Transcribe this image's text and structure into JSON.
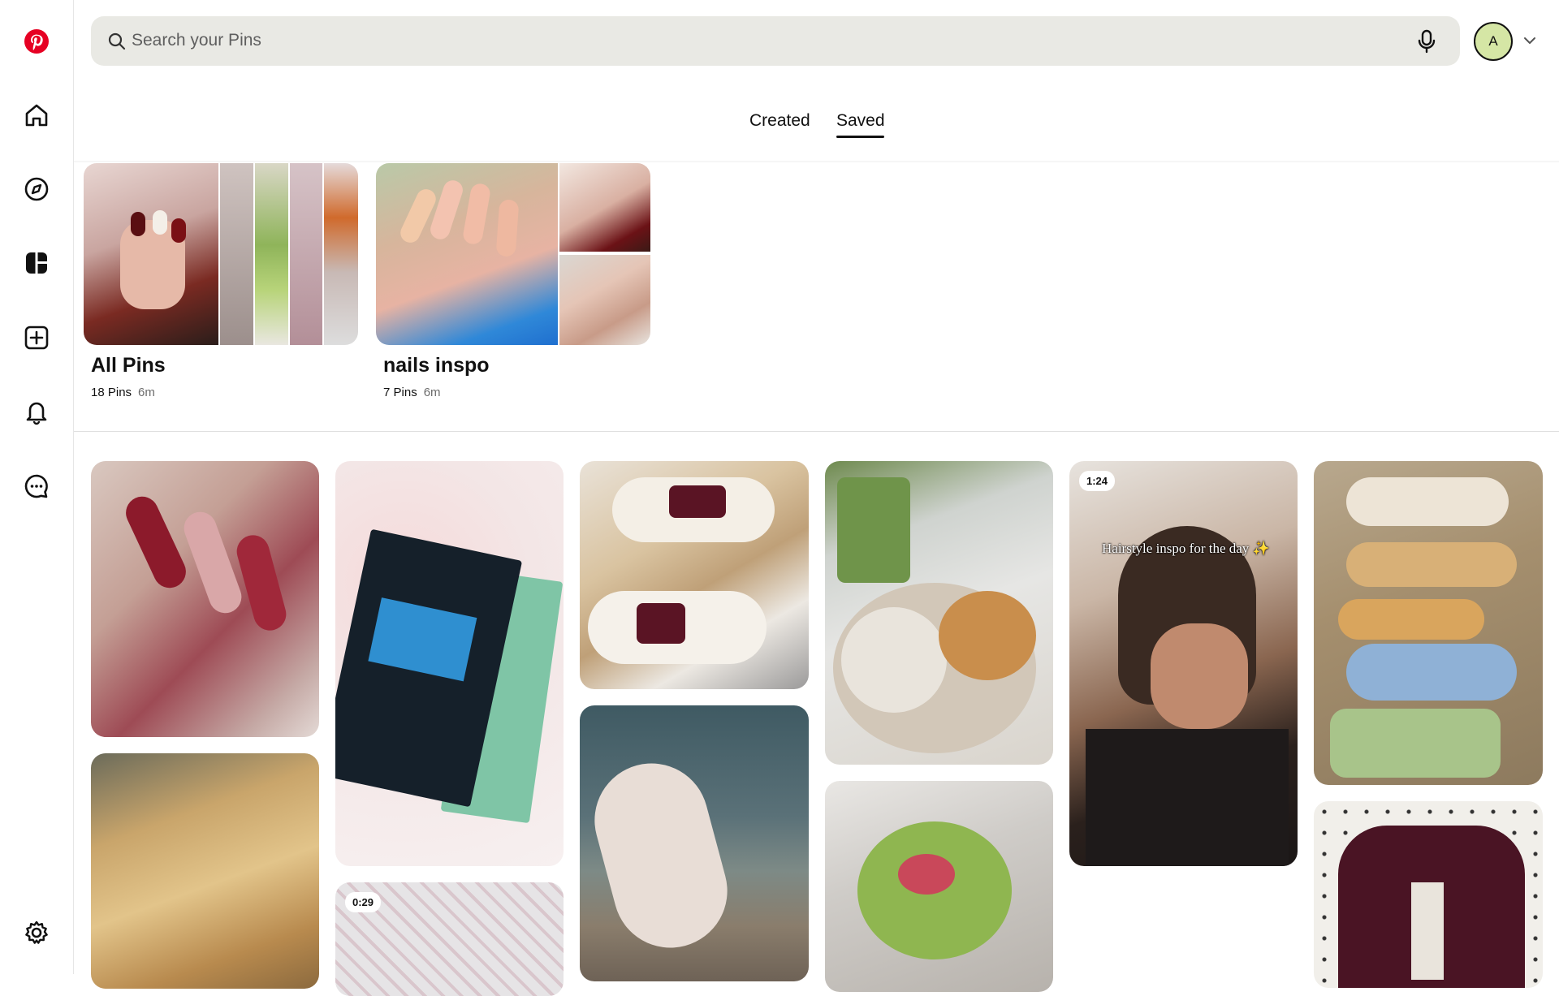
{
  "search": {
    "placeholder": "Search your Pins"
  },
  "user": {
    "avatar_letter": "A"
  },
  "tabs": [
    {
      "label": "Created"
    },
    {
      "label": "Saved"
    }
  ],
  "active_tab": "Saved",
  "boards": [
    {
      "title": "All Pins",
      "count": "18 Pins",
      "updated": "6m"
    },
    {
      "title": "nails inspo",
      "count": "7 Pins",
      "updated": "6m"
    }
  ],
  "pins": [
    {
      "badge": null
    },
    {
      "badge": null
    },
    {
      "badge": null
    },
    {
      "badge": null
    },
    {
      "badge": "1:24",
      "overlay": "Hairstyle inspo for the day ✨"
    },
    {
      "badge": null
    },
    {
      "badge": null
    },
    {
      "badge": "0:29"
    },
    {
      "badge": null
    },
    {
      "badge": null
    },
    {
      "badge": null
    },
    {
      "badge": null
    }
  ],
  "icons": {
    "logo": "pinterest-logo-icon",
    "home": "home-icon",
    "explore": "compass-icon",
    "boards": "boards-icon",
    "create": "create-plus-icon",
    "notifications": "bell-icon",
    "messages": "message-icon",
    "settings": "gear-icon"
  },
  "colors": {
    "brand": "#e60023",
    "search_bg": "#e9e9e4",
    "avatar_bg": "#d5e6a5"
  }
}
